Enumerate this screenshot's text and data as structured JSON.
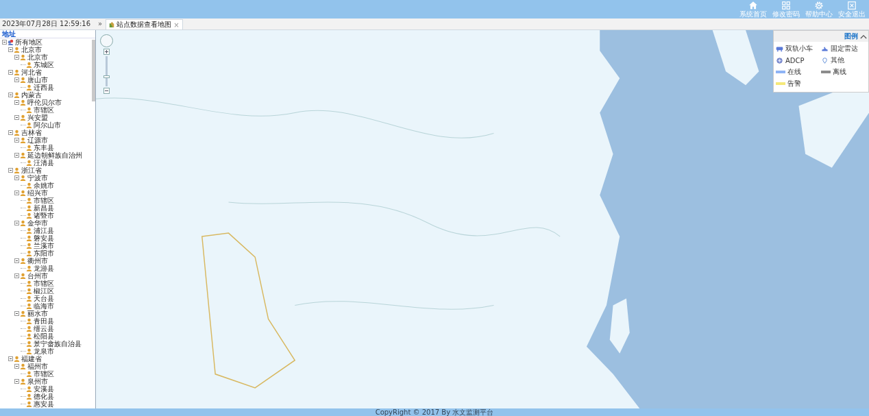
{
  "header": {
    "buttons": [
      {
        "label": "系统首页"
      },
      {
        "label": "修改密码"
      },
      {
        "label": "帮助中心"
      },
      {
        "label": "安全退出"
      }
    ]
  },
  "tab_bar": {
    "datetime": "2023年07月28日 12:59:16",
    "collapse": "»",
    "tabs": [
      {
        "label": "站点数据查看地图",
        "selected": true,
        "close": "×"
      }
    ]
  },
  "sidebar": {
    "title": "地址",
    "tree": [
      {
        "label": "所有地区",
        "kind": "root",
        "expanded": true,
        "children": [
          {
            "label": "北京市",
            "expanded": true,
            "children": [
              {
                "label": "北京市",
                "expanded": true,
                "children": [
                  {
                    "label": "东城区"
                  }
                ]
              }
            ]
          },
          {
            "label": "河北省",
            "expanded": true,
            "children": [
              {
                "label": "唐山市",
                "expanded": true,
                "children": [
                  {
                    "label": "迁西县"
                  }
                ]
              }
            ]
          },
          {
            "label": "内蒙古",
            "expanded": true,
            "children": [
              {
                "label": "呼伦贝尔市",
                "expanded": true,
                "children": [
                  {
                    "label": "市辖区"
                  }
                ]
              },
              {
                "label": "兴安盟",
                "expanded": true,
                "children": [
                  {
                    "label": "阿尔山市"
                  }
                ]
              }
            ]
          },
          {
            "label": "吉林省",
            "expanded": true,
            "children": [
              {
                "label": "辽源市",
                "expanded": true,
                "children": [
                  {
                    "label": "东丰县"
                  }
                ]
              },
              {
                "label": "延边朝鲜族自治州",
                "expanded": true,
                "children": [
                  {
                    "label": "汪清县"
                  }
                ]
              }
            ]
          },
          {
            "label": "浙江省",
            "expanded": true,
            "children": [
              {
                "label": "宁波市",
                "expanded": true,
                "children": [
                  {
                    "label": "余姚市"
                  }
                ]
              },
              {
                "label": "绍兴市",
                "expanded": true,
                "children": [
                  {
                    "label": "市辖区"
                  },
                  {
                    "label": "新昌县"
                  },
                  {
                    "label": "诸暨市"
                  }
                ]
              },
              {
                "label": "金华市",
                "expanded": true,
                "children": [
                  {
                    "label": "浦江县"
                  },
                  {
                    "label": "磐安县"
                  },
                  {
                    "label": "兰溪市"
                  },
                  {
                    "label": "东阳市"
                  }
                ]
              },
              {
                "label": "衢州市",
                "expanded": true,
                "children": [
                  {
                    "label": "龙游县"
                  }
                ]
              },
              {
                "label": "台州市",
                "expanded": true,
                "children": [
                  {
                    "label": "市辖区"
                  },
                  {
                    "label": "椒江区"
                  },
                  {
                    "label": "天台县"
                  },
                  {
                    "label": "临海市"
                  }
                ]
              },
              {
                "label": "丽水市",
                "expanded": true,
                "children": [
                  {
                    "label": "青田县"
                  },
                  {
                    "label": "缙云县"
                  },
                  {
                    "label": "松阳县"
                  },
                  {
                    "label": "景宁畲族自治县"
                  },
                  {
                    "label": "龙泉市"
                  }
                ]
              }
            ]
          },
          {
            "label": "福建省",
            "expanded": true,
            "children": [
              {
                "label": "福州市",
                "expanded": true,
                "children": [
                  {
                    "label": "市辖区"
                  }
                ]
              },
              {
                "label": "泉州市",
                "expanded": true,
                "children": [
                  {
                    "label": "安溪县"
                  },
                  {
                    "label": "德化县"
                  },
                  {
                    "label": "惠安县"
                  }
                ]
              }
            ]
          }
        ]
      }
    ]
  },
  "map": {
    "zoom": {
      "level": 0.3
    }
  },
  "legend": {
    "title": "图例",
    "items": [
      {
        "label": "双轨小车",
        "kind": "car"
      },
      {
        "label": "固定雷达",
        "kind": "radar"
      },
      {
        "label": "ADCP",
        "kind": "adcp"
      },
      {
        "label": "其他",
        "kind": "pin"
      },
      {
        "label": "在线",
        "kind": "swatch",
        "color": "#8fb4f5"
      },
      {
        "label": "离线",
        "kind": "swatch",
        "color": "#8c8c8c"
      },
      {
        "label": "告警",
        "kind": "swatch",
        "color": "#f5e97a"
      }
    ]
  },
  "footer": {
    "text": "CopyRight © 2017 By 水文监测平台"
  }
}
